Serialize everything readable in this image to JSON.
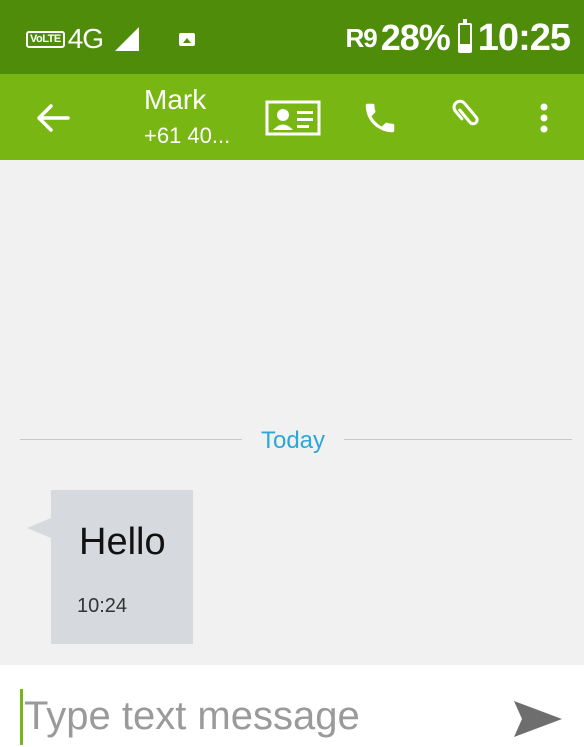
{
  "status_bar": {
    "volte_label": "VoLTE",
    "network_label": "4G",
    "carrier_label": "R9",
    "battery_percent": "28%",
    "battery_level": 0.28,
    "time": "10:25"
  },
  "header": {
    "contact_name": "Mark",
    "contact_number": "+61 40...",
    "icons": {
      "back": "arrow-left-icon",
      "contact_card": "contact-card-icon",
      "call": "phone-icon",
      "attach": "paperclip-icon",
      "more": "more-vertical-icon"
    }
  },
  "conversation": {
    "date_separator": "Today",
    "messages": [
      {
        "text": "Hello",
        "time": "10:24",
        "direction": "incoming"
      }
    ]
  },
  "composer": {
    "placeholder": "Type text message",
    "value": "",
    "send_icon": "send-icon"
  },
  "colors": {
    "status_bar": "#4e8c0a",
    "action_bar": "#78b614",
    "background": "#f1f1f1",
    "bubble": "#d6dade",
    "date_label": "#2ea6d8",
    "send_icon": "#6e6e6e"
  }
}
